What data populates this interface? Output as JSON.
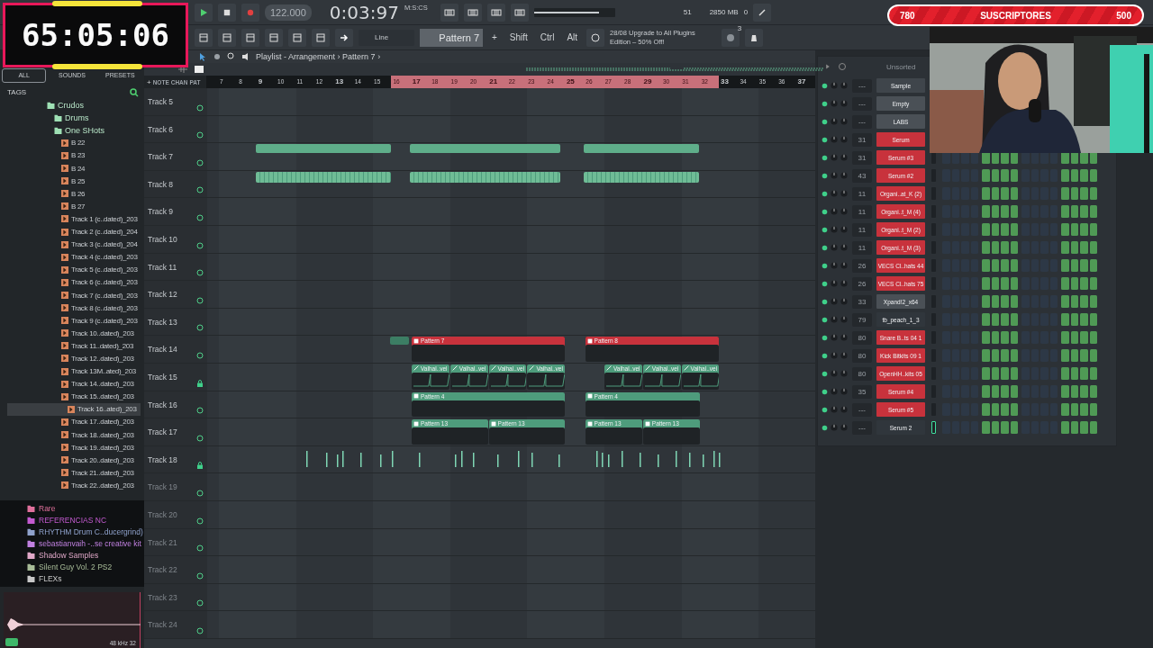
{
  "timer": {
    "text": "65:05:06"
  },
  "transport": {
    "tempo": "122.000",
    "time": "0:03:97",
    "time_unit": "M:S:CS",
    "cpu": "51",
    "memory": "2850 MB",
    "polyphony": "0",
    "playing": false,
    "master_volume": {
      "level": 0.8
    }
  },
  "toolbar": {
    "snap": "Line",
    "pattern": "Pattern 7",
    "add": "+",
    "modifiers": [
      "Shift",
      "Ctrl",
      "Alt"
    ],
    "news_date": "28/08",
    "news": "Upgrade to All Plugins Edition – 50% Off!",
    "badge": "3"
  },
  "subscribers": {
    "current": "780",
    "label": "SUSCRIPTORES",
    "goal": "500"
  },
  "browser": {
    "tabs": [
      {
        "label": "ALL",
        "selected": true
      },
      {
        "label": "SOUNDS",
        "selected": false
      },
      {
        "label": "PRESETS",
        "selected": false
      }
    ],
    "tags": "TAGS",
    "tree": [
      {
        "label": "Crudos",
        "kind": "folder",
        "selected": false,
        "children": [
          {
            "label": "Drums",
            "kind": "folder",
            "selected": false
          },
          {
            "label": "One SHots",
            "kind": "folder",
            "selected": false,
            "children": [
              {
                "label": "B 22",
                "kind": "file",
                "selected": false
              },
              {
                "label": "B 23",
                "kind": "file",
                "selected": false
              },
              {
                "label": "B 24",
                "kind": "file",
                "selected": false
              },
              {
                "label": "B 25",
                "kind": "file",
                "selected": false
              },
              {
                "label": "B 26",
                "kind": "file",
                "selected": false
              },
              {
                "label": "B 27",
                "kind": "file",
                "selected": false
              },
              {
                "label": "Track 1 (c..dated)_203",
                "kind": "file",
                "selected": false
              },
              {
                "label": "Track 2 (c..dated)_204",
                "kind": "file",
                "selected": false
              },
              {
                "label": "Track 3 (c..dated)_204",
                "kind": "file",
                "selected": false
              },
              {
                "label": "Track 4 (c..dated)_203",
                "kind": "file",
                "selected": false
              },
              {
                "label": "Track 5 (c..dated)_203",
                "kind": "file",
                "selected": false
              },
              {
                "label": "Track 6 (c..dated)_203",
                "kind": "file",
                "selected": false
              },
              {
                "label": "Track 7 (c..dated)_203",
                "kind": "file",
                "selected": false
              },
              {
                "label": "Track 8 (c..dated)_203",
                "kind": "file",
                "selected": false
              },
              {
                "label": "Track 9 (c..dated)_203",
                "kind": "file",
                "selected": false
              },
              {
                "label": "Track 10..dated)_203",
                "kind": "file",
                "selected": false
              },
              {
                "label": "Track 11..dated)_203",
                "kind": "file",
                "selected": false
              },
              {
                "label": "Track 12..dated)_203",
                "kind": "file",
                "selected": false
              },
              {
                "label": "Track 13M..ated)_203",
                "kind": "file",
                "selected": false
              },
              {
                "label": "Track 14..dated)_203",
                "kind": "file",
                "selected": false
              },
              {
                "label": "Track 15..dated)_203",
                "kind": "file",
                "selected": false
              },
              {
                "label": "Track 16..ated)_203",
                "kind": "file",
                "selected": true
              },
              {
                "label": "Track 17..dated)_203",
                "kind": "file",
                "selected": false
              },
              {
                "label": "Track 18..dated)_203",
                "kind": "file",
                "selected": false
              },
              {
                "label": "Track 19..dated)_203",
                "kind": "file",
                "selected": false
              },
              {
                "label": "Track 20..dated)_203",
                "kind": "file",
                "selected": false
              },
              {
                "label": "Track 21..dated)_203",
                "kind": "file",
                "selected": false
              },
              {
                "label": "Track 22..dated)_203",
                "kind": "file",
                "selected": false
              }
            ]
          }
        ]
      }
    ],
    "folders": [
      {
        "label": "Rare",
        "color": "#e0709c"
      },
      {
        "label": "REFERENCIAS NC",
        "color": "#c45ad0"
      },
      {
        "label": "RHYTHM Drum C..ducergrind)",
        "color": "#8fa2cc"
      },
      {
        "label": "sebastianvaih -..se creative kit",
        "color": "#c080e0"
      },
      {
        "label": "Shadow Samples",
        "color": "#e0a8c8"
      },
      {
        "label": "Silent Guy Vol. 2 PS2",
        "color": "#a8bc98"
      },
      {
        "label": "FLEXs",
        "color": "#c8c8c8"
      }
    ],
    "preview": {
      "info": "48 kHz 32"
    }
  },
  "playlist": {
    "title": "Playlist - Arrangement",
    "crumb": "Pattern 7",
    "separator": "›",
    "add": "+",
    "ruler_modes": [
      "NOTE",
      "CHAN",
      "PAT"
    ],
    "bars": [
      {
        "label": "7",
        "bold": false,
        "looped": false
      },
      {
        "label": "8",
        "bold": false,
        "looped": false
      },
      {
        "label": "9",
        "bold": true,
        "looped": false
      },
      {
        "label": "10",
        "bold": false,
        "looped": false
      },
      {
        "label": "11",
        "bold": false,
        "looped": false
      },
      {
        "label": "12",
        "bold": false,
        "looped": false
      },
      {
        "label": "13",
        "bold": true,
        "looped": false
      },
      {
        "label": "14",
        "bold": false,
        "looped": false
      },
      {
        "label": "15",
        "bold": false,
        "looped": false
      },
      {
        "label": "16",
        "bold": false,
        "looped": true
      },
      {
        "label": "17",
        "bold": true,
        "looped": true
      },
      {
        "label": "18",
        "bold": false,
        "looped": true
      },
      {
        "label": "19",
        "bold": false,
        "looped": true
      },
      {
        "label": "20",
        "bold": false,
        "looped": true
      },
      {
        "label": "21",
        "bold": true,
        "looped": true
      },
      {
        "label": "22",
        "bold": false,
        "looped": true
      },
      {
        "label": "23",
        "bold": false,
        "looped": true
      },
      {
        "label": "24",
        "bold": false,
        "looped": true
      },
      {
        "label": "25",
        "bold": true,
        "looped": true
      },
      {
        "label": "26",
        "bold": false,
        "looped": true
      },
      {
        "label": "27",
        "bold": false,
        "looped": true
      },
      {
        "label": "28",
        "bold": false,
        "looped": true
      },
      {
        "label": "29",
        "bold": true,
        "looped": true
      },
      {
        "label": "30",
        "bold": false,
        "looped": true
      },
      {
        "label": "31",
        "bold": false,
        "looped": true
      },
      {
        "label": "32",
        "bold": false,
        "looped": true
      },
      {
        "label": "33",
        "bold": true,
        "looped": false
      },
      {
        "label": "34",
        "bold": false,
        "looped": false
      },
      {
        "label": "35",
        "bold": false,
        "looped": false
      },
      {
        "label": "36",
        "bold": false,
        "looped": false
      },
      {
        "label": "37",
        "bold": true,
        "looped": false
      }
    ],
    "tracks": [
      {
        "name": "Track 5",
        "muted": false,
        "locked": false
      },
      {
        "name": "Track 6",
        "muted": false,
        "locked": false
      },
      {
        "name": "Track 7",
        "muted": false,
        "locked": false
      },
      {
        "name": "Track 8",
        "muted": false,
        "locked": false
      },
      {
        "name": "Track 9",
        "muted": false,
        "locked": false
      },
      {
        "name": "Track 10",
        "muted": false,
        "locked": false
      },
      {
        "name": "Track 11",
        "muted": false,
        "locked": false
      },
      {
        "name": "Track 12",
        "muted": false,
        "locked": false
      },
      {
        "name": "Track 13",
        "muted": false,
        "locked": false
      },
      {
        "name": "Track 14",
        "muted": false,
        "locked": false,
        "clips": [
          {
            "label": "Pattern 7",
            "kind": "pattern",
            "color": "#c8323c"
          },
          {
            "label": "Pattern 8",
            "kind": "pattern",
            "color": "#c8323c"
          }
        ]
      },
      {
        "name": "Track 15",
        "muted": false,
        "locked": true,
        "clips": [
          {
            "label": "Valhal..vel",
            "kind": "automation",
            "color": "#4e9c7c"
          },
          {
            "label": "Valhal..vel",
            "kind": "automation",
            "color": "#4e9c7c"
          },
          {
            "label": "Valhal..vel",
            "kind": "automation",
            "color": "#4e9c7c"
          },
          {
            "label": "Valhal..vel",
            "kind": "automation",
            "color": "#4e9c7c"
          },
          {
            "label": "Valhal..vel",
            "kind": "automation",
            "color": "#4e9c7c"
          },
          {
            "label": "Valhal..vel",
            "kind": "automation",
            "color": "#4e9c7c"
          },
          {
            "label": "Valhal..vel",
            "kind": "automation",
            "color": "#4e9c7c"
          }
        ]
      },
      {
        "name": "Track 16",
        "muted": false,
        "locked": false,
        "clips": [
          {
            "label": "Pattern 4",
            "kind": "pattern",
            "color": "#4e9c7c"
          },
          {
            "label": "Pattern 4",
            "kind": "pattern",
            "color": "#4e9c7c"
          }
        ]
      },
      {
        "name": "Track 17",
        "muted": false,
        "locked": false,
        "clips": [
          {
            "label": "Pattern 13",
            "kind": "pattern",
            "color": "#4e9c7c"
          },
          {
            "label": "Pattern 13",
            "kind": "pattern",
            "color": "#4e9c7c"
          },
          {
            "label": "Pattern 13",
            "kind": "pattern",
            "color": "#4e9c7c"
          },
          {
            "label": "Pattern 13",
            "kind": "pattern",
            "color": "#4e9c7c"
          }
        ]
      },
      {
        "name": "Track 18",
        "muted": false,
        "locked": true
      },
      {
        "name": "Track 19",
        "muted": true,
        "locked": false
      },
      {
        "name": "Track 20",
        "muted": true,
        "locked": false
      },
      {
        "name": "Track 21",
        "muted": true,
        "locked": false
      },
      {
        "name": "Track 22",
        "muted": true,
        "locked": false
      },
      {
        "name": "Track 23",
        "muted": true,
        "locked": false
      },
      {
        "name": "Track 24",
        "muted": true,
        "locked": false
      }
    ]
  },
  "channel_rack": {
    "group": "Unsorted",
    "channels": [
      {
        "number": "---",
        "name": "Sample",
        "color": "#3f454b"
      },
      {
        "number": "---",
        "name": "Empty",
        "color": "#4a5056"
      },
      {
        "number": "---",
        "name": "LABS",
        "color": "#4a5056"
      },
      {
        "number": "31",
        "name": "Serum",
        "color": "#c8323c"
      },
      {
        "number": "31",
        "name": "Serum #3",
        "color": "#c8323c",
        "selected": false,
        "steps": [
          false,
          false,
          false,
          false,
          true,
          true,
          true,
          true,
          false,
          false,
          false,
          false,
          true,
          true,
          true,
          true
        ]
      },
      {
        "number": "43",
        "name": "Serum #2",
        "color": "#c8323c",
        "selected": false,
        "steps": [
          false,
          false,
          false,
          false,
          true,
          true,
          true,
          true,
          false,
          false,
          false,
          false,
          true,
          true,
          true,
          true
        ]
      },
      {
        "number": "11",
        "name": "Organi..at_K (2)",
        "color": "#c8323c",
        "selected": false,
        "steps": [
          false,
          false,
          false,
          false,
          true,
          true,
          true,
          true,
          false,
          false,
          false,
          false,
          true,
          true,
          true,
          true
        ]
      },
      {
        "number": "11",
        "name": "Organi..t_M (4)",
        "color": "#c8323c",
        "selected": false,
        "steps": [
          false,
          false,
          false,
          false,
          true,
          true,
          true,
          true,
          false,
          false,
          false,
          false,
          true,
          true,
          true,
          true
        ]
      },
      {
        "number": "11",
        "name": "Organi..t_M (2)",
        "color": "#c8323c",
        "selected": false,
        "steps": [
          false,
          false,
          false,
          false,
          true,
          true,
          true,
          true,
          false,
          false,
          false,
          false,
          true,
          true,
          true,
          true
        ]
      },
      {
        "number": "11",
        "name": "Organi..t_M (3)",
        "color": "#c8323c",
        "selected": false,
        "steps": [
          false,
          false,
          false,
          false,
          true,
          true,
          true,
          true,
          false,
          false,
          false,
          false,
          true,
          true,
          true,
          true
        ]
      },
      {
        "number": "26",
        "name": "VECS Cl..hats 44",
        "color": "#c8323c",
        "selected": false,
        "steps": [
          false,
          false,
          false,
          false,
          true,
          true,
          true,
          true,
          false,
          false,
          false,
          false,
          true,
          true,
          true,
          true
        ]
      },
      {
        "number": "26",
        "name": "VECS Cl..hats 75",
        "color": "#c8323c",
        "selected": false,
        "steps": [
          false,
          false,
          false,
          false,
          true,
          true,
          true,
          true,
          false,
          false,
          false,
          false,
          true,
          true,
          true,
          true
        ]
      },
      {
        "number": "33",
        "name": "Xpand!2_x64",
        "color": "#4a5056",
        "selected": false,
        "steps": [
          false,
          false,
          false,
          false,
          true,
          true,
          true,
          true,
          false,
          false,
          false,
          false,
          true,
          true,
          true,
          true
        ]
      },
      {
        "number": "79",
        "name": "tb_peach_1_3",
        "color": "#30363c",
        "selected": false,
        "steps": [
          false,
          false,
          false,
          false,
          true,
          true,
          true,
          true,
          false,
          false,
          false,
          false,
          true,
          true,
          true,
          true
        ]
      },
      {
        "number": "80",
        "name": "Snare B..ts 04 1",
        "color": "#c8323c",
        "selected": false,
        "steps": [
          false,
          false,
          false,
          false,
          true,
          true,
          true,
          true,
          false,
          false,
          false,
          false,
          true,
          true,
          true,
          true
        ]
      },
      {
        "number": "80",
        "name": "Kick Bitkits 09 1",
        "color": "#c8323c",
        "selected": false,
        "steps": [
          false,
          false,
          false,
          false,
          true,
          true,
          true,
          true,
          false,
          false,
          false,
          false,
          true,
          true,
          true,
          true
        ]
      },
      {
        "number": "80",
        "name": "OpenHH..kits 05",
        "color": "#c8323c",
        "selected": false,
        "steps": [
          false,
          false,
          false,
          false,
          true,
          true,
          true,
          true,
          false,
          false,
          false,
          false,
          true,
          true,
          true,
          true
        ]
      },
      {
        "number": "35",
        "name": "Serum #4",
        "color": "#c8323c",
        "selected": false,
        "steps": [
          false,
          false,
          false,
          false,
          true,
          true,
          true,
          true,
          false,
          false,
          false,
          false,
          true,
          true,
          true,
          true
        ]
      },
      {
        "number": "---",
        "name": "Serum #5",
        "color": "#c8323c",
        "selected": false,
        "steps": [
          false,
          false,
          false,
          false,
          true,
          true,
          true,
          true,
          false,
          false,
          false,
          false,
          true,
          true,
          true,
          true
        ]
      },
      {
        "number": "---",
        "name": "Serum 2",
        "color": "#30363c",
        "selected": true,
        "steps": [
          false,
          false,
          false,
          false,
          true,
          true,
          true,
          true,
          false,
          false,
          false,
          false,
          true,
          true,
          true,
          true
        ]
      }
    ]
  }
}
